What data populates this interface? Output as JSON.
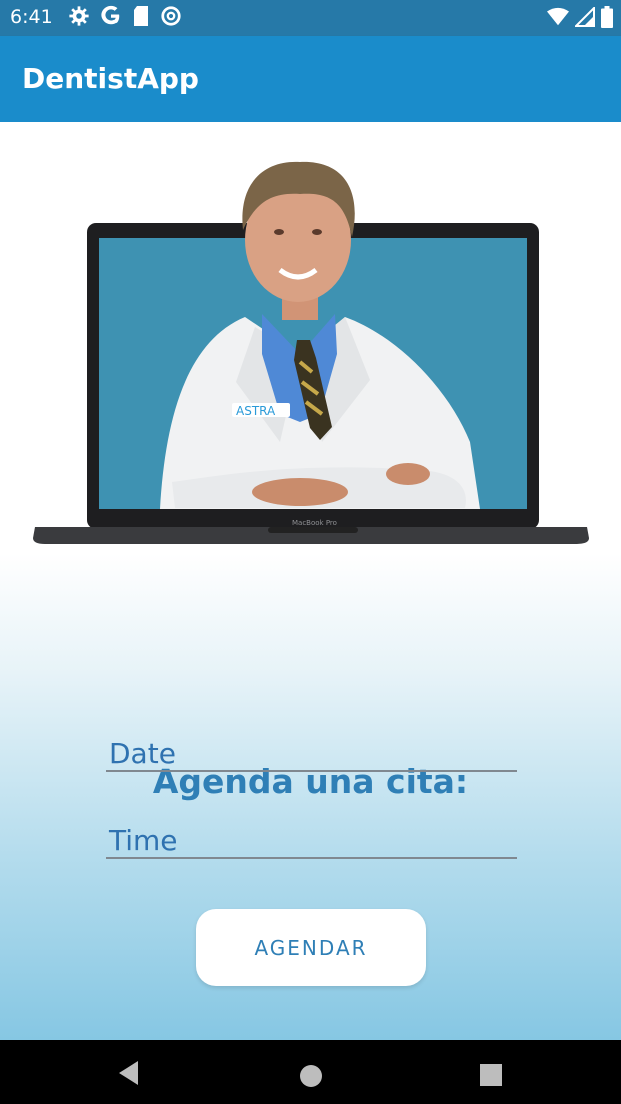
{
  "status_bar": {
    "time": "6:41",
    "left_icons": [
      "gear-icon",
      "google-g-icon",
      "sd-card-icon",
      "data-saver-icon"
    ],
    "right_icons": [
      "wifi-icon",
      "signal-icon",
      "battery-icon"
    ]
  },
  "app_bar": {
    "title": "DentistApp",
    "color": "#1a8ccb"
  },
  "hero": {
    "image": "dentist-on-laptop-illustration",
    "laptop_label": "MacBook Pro",
    "coat_logo_text": "ASTRA"
  },
  "form": {
    "heading": "Agenda una cita:",
    "date_field": {
      "value": "Date"
    },
    "time_field": {
      "value": "Time"
    },
    "submit_label": "AGENDAR"
  },
  "nav_bar": {
    "buttons": [
      "back-icon",
      "home-icon",
      "recents-icon"
    ]
  },
  "colors": {
    "accent": "#2f7fb6",
    "status_bar": "#2679a8",
    "gradient_bottom": "#86c7e3"
  }
}
